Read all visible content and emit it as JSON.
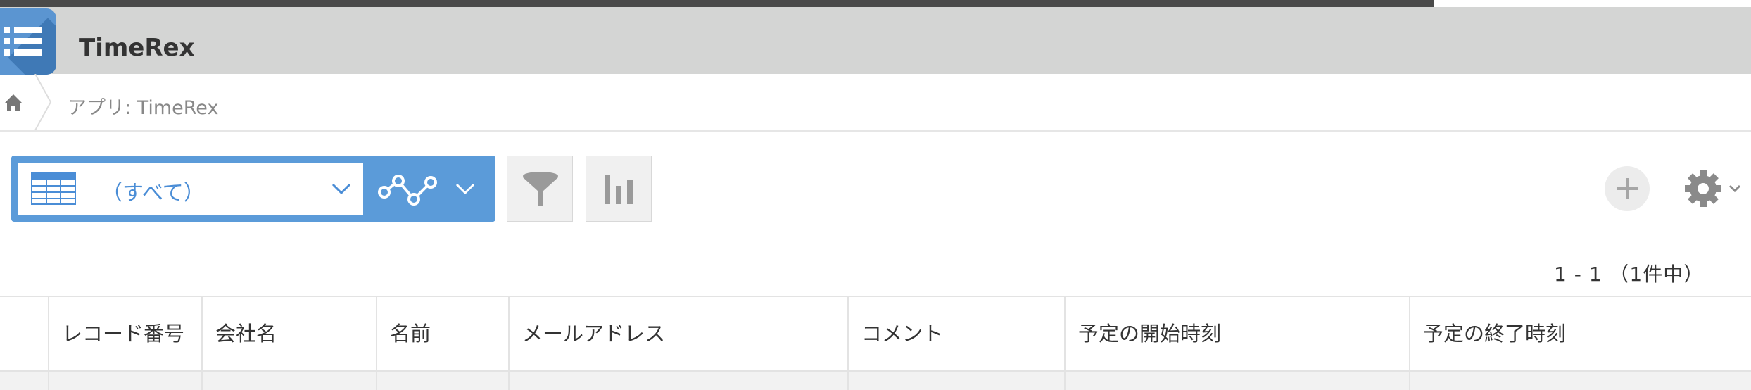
{
  "app": {
    "title": "TimeRex"
  },
  "breadcrumb": {
    "text": "アプリ: TimeRex"
  },
  "toolbar": {
    "view_label": "（すべて）",
    "icons": [
      "table-icon",
      "graph-icon",
      "filter-icon",
      "bar-chart-icon",
      "plus-icon",
      "gear-icon"
    ]
  },
  "pager": {
    "text": "1 - 1 （1件中）"
  },
  "table": {
    "columns": [
      "",
      "レコード番号",
      "会社名",
      "名前",
      "メールアドレス",
      "コメント",
      "予定の開始時刻",
      "予定の終了時刻"
    ]
  },
  "colors": {
    "header_bg": "#d4d5d4",
    "accent": "#5b9bd9",
    "view_text": "#4a8dd6"
  }
}
